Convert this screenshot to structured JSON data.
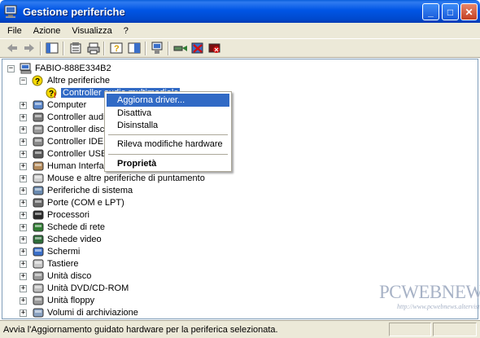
{
  "window": {
    "title": "Gestione periferiche",
    "controls": {
      "minimize": "_",
      "maximize": "□",
      "close": "✕"
    }
  },
  "menu": [
    "File",
    "Azione",
    "Visualizza",
    "?"
  ],
  "toolbar": [
    "back-arrow-icon",
    "forward-arrow-icon",
    "show-hide-tree-icon",
    "properties-icon",
    "print-icon",
    "help-icon",
    "console-view-icon",
    "scan-hardware-icon",
    "update-driver-icon",
    "uninstall-icon",
    "disable-icon"
  ],
  "tree": {
    "root": "FABIO-888E334B2",
    "other_devices": "Altre periferiche",
    "selected_device": "Controller audio multimediale",
    "categories": [
      "Computer",
      "Controller audio, video e giochi",
      "Controller disco floppy",
      "Controller IDE ATA/ATAPI",
      "Controller USB (Universal Serial Bus)",
      "Human Interface Device (HID)",
      "Mouse e altre periferiche di puntamento",
      "Periferiche di sistema",
      "Porte (COM e LPT)",
      "Processori",
      "Schede di rete",
      "Schede video",
      "Schermi",
      "Tastiere",
      "Unità disco",
      "Unità DVD/CD-ROM",
      "Unità floppy",
      "Volumi di archiviazione"
    ],
    "expander_plus": "+",
    "expander_minus": "−"
  },
  "context_menu": {
    "update_driver": "Aggiorna driver...",
    "disable": "Disattiva",
    "uninstall": "Disinstalla",
    "scan": "Rileva modifiche hardware",
    "properties": "Proprietà"
  },
  "status": "Avvia l'Aggiornamento guidato hardware per la periferica selezionata.",
  "watermark": {
    "title": "PCWEBNEWS",
    "subtitle": "http://www.pcwebnews.altervista.org"
  },
  "colors": {
    "titlebar": "#0055e5",
    "selection": "#316ac5",
    "chrome": "#ece9d8"
  }
}
